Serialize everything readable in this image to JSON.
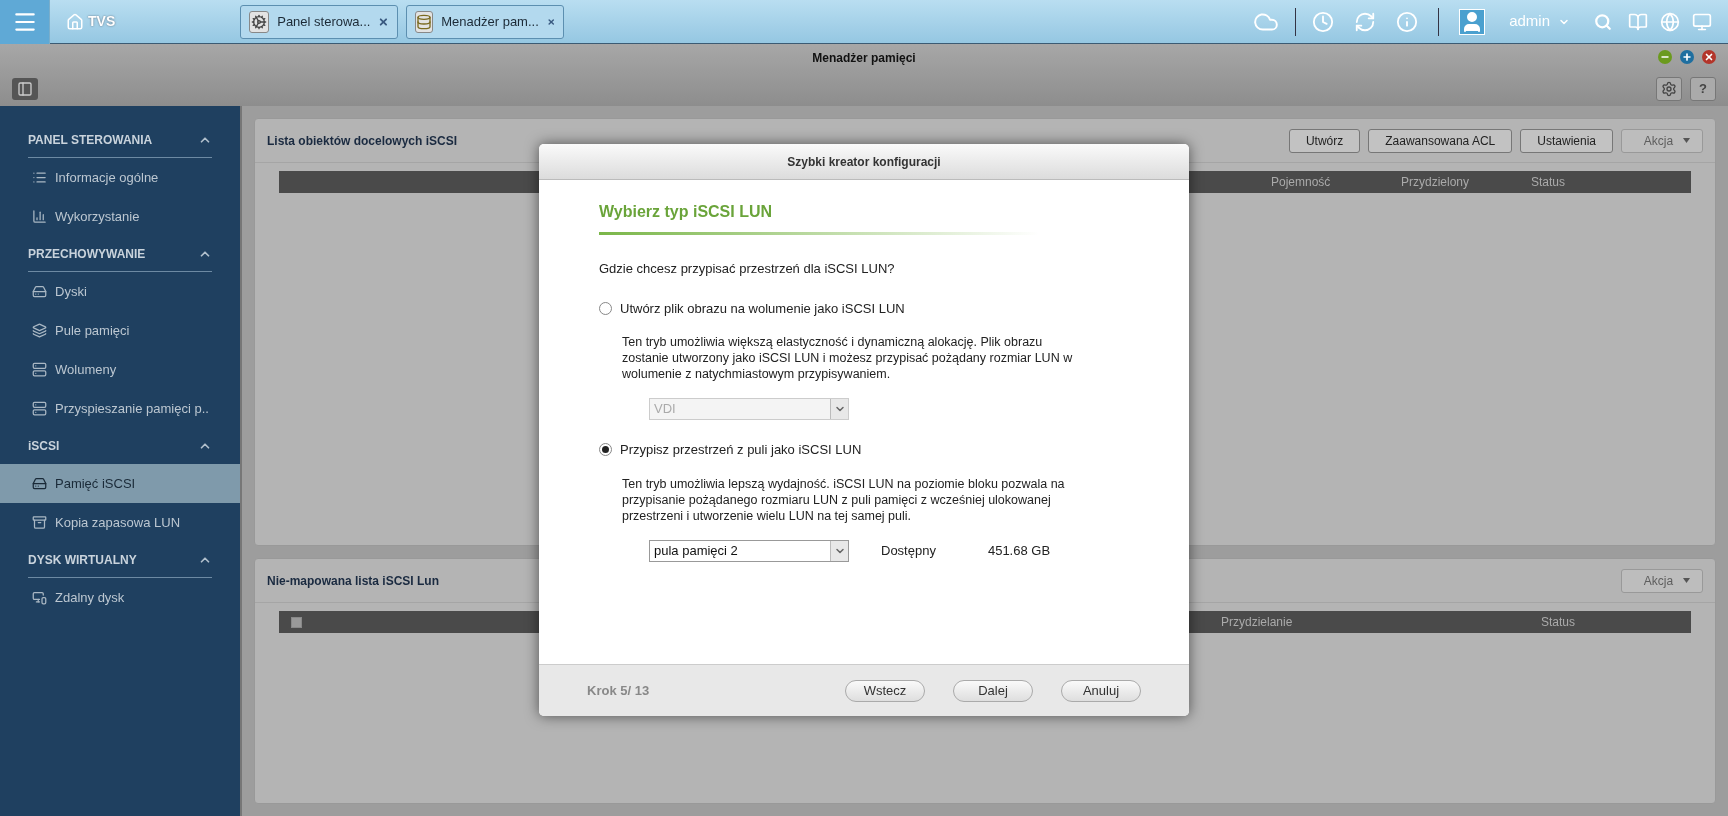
{
  "topbar": {
    "home": "TVS",
    "tabs": [
      {
        "label": "Panel sterowa..."
      },
      {
        "label": "Menadżer pam..."
      }
    ],
    "user": "admin"
  },
  "window": {
    "title": "Menadżer pamięci",
    "help": "?"
  },
  "sidebar": [
    {
      "title": "PANEL STEROWANIA",
      "expanded": true,
      "items": [
        {
          "label": "Informacje ogólne",
          "selected": false
        },
        {
          "label": "Wykorzystanie",
          "selected": false
        }
      ]
    },
    {
      "title": "PRZECHOWYWANIE",
      "expanded": true,
      "items": [
        {
          "label": "Dyski",
          "selected": false
        },
        {
          "label": "Pule pamięci",
          "selected": false
        },
        {
          "label": "Wolumeny",
          "selected": false
        },
        {
          "label": "Przyspieszanie pamięci p..",
          "selected": false
        }
      ]
    },
    {
      "title": "iSCSI",
      "expanded": true,
      "items": [
        {
          "label": "Pamięć iSCSI",
          "selected": true
        },
        {
          "label": "Kopia zapasowa LUN",
          "selected": false
        }
      ]
    },
    {
      "title": "DYSK WIRTUALNY",
      "expanded": true,
      "items": [
        {
          "label": "Zdalny dysk",
          "selected": false
        }
      ]
    }
  ],
  "targets_panel": {
    "title": "Lista obiektów docelowych iSCSI",
    "buttons": [
      {
        "label": "Utwórz",
        "disabled": false
      },
      {
        "label": "Zaawansowana ACL",
        "disabled": false
      },
      {
        "label": "Ustawienia",
        "disabled": false
      }
    ],
    "action": {
      "label": "Akcja",
      "disabled": true
    },
    "columns": [
      "Pojemność",
      "Przydzielony",
      "Status"
    ]
  },
  "unmapped_panel": {
    "title": "Nie-mapowana lista iSCSI Lun",
    "action": {
      "label": "Akcja",
      "disabled": true
    },
    "select_all": {
      "checked": false
    },
    "columns": [
      "Przydzielanie",
      "Status"
    ]
  },
  "dialog": {
    "title": "Szybki kreator konfiguracji",
    "heading": "Wybierz typ iSCSI LUN",
    "question": "Gdzie chcesz przypisać przestrzeń dla iSCSI LUN?",
    "options": [
      {
        "label": "Utwórz plik obrazu na wolumenie jako iSCSI LUN",
        "selected": false,
        "description": "Ten tryb umożliwia większą elastyczność i dynamiczną alokację. Plik obrazu zostanie utworzony jako iSCSI LUN i możesz przypisać pożądany rozmiar LUN w wolumenie z natychmiastowym przypisywaniem.",
        "select": {
          "value": "VDI",
          "disabled": true
        }
      },
      {
        "label": "Przypisz przestrzeń z puli jako iSCSI LUN",
        "selected": true,
        "description": "Ten tryb umożliwia lepszą wydajność. iSCSI LUN na poziomie bloku pozwala na przypisanie pożądanego rozmiaru LUN z puli pamięci z wcześniej ulokowanej przestrzeni i utworzenie wielu LUN na tej samej puli.",
        "select": {
          "value": "pula pamięci 2",
          "disabled": false
        },
        "available_label": "Dostępny",
        "available_value": "451.68 GB"
      }
    ],
    "step": "Krok 5/ 13",
    "buttons": [
      "Wstecz",
      "Dalej",
      "Anuluj"
    ]
  }
}
